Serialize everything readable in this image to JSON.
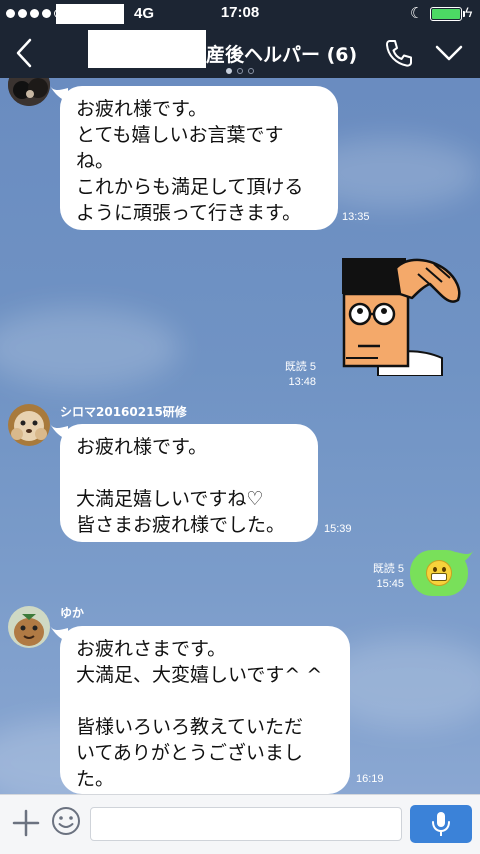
{
  "status_bar": {
    "network": "4G",
    "time": "17:08"
  },
  "header": {
    "title": "産後ヘルパー (6)"
  },
  "messages": [
    {
      "text": "お疲れ様です。\nとても嬉しいお言葉です\nね。\nこれからも満足して頂ける\nように頑張って行きます。",
      "time": "13:35"
    },
    {
      "read": "既読 5",
      "time": "13:48"
    },
    {
      "sender": "シロマ20160215研修",
      "text": "お疲れ様です。\n\n大満足嬉しいですね♡\n皆さまお疲れ様でした。",
      "time": "15:39"
    },
    {
      "read": "既読 5",
      "time": "15:45"
    },
    {
      "sender": "ゆか",
      "text": "お疲れさまです。\n大満足、大変嬉しいです^ ^\n\n皆様いろいろ教えていただ\nいてありがとうございまし\nた。",
      "time": "16:19"
    }
  ],
  "input": {
    "placeholder": ""
  },
  "colors": {
    "header_bg": "#1c2533",
    "sent_bubble": "#79e05a",
    "mic_button": "#3b82d8"
  }
}
